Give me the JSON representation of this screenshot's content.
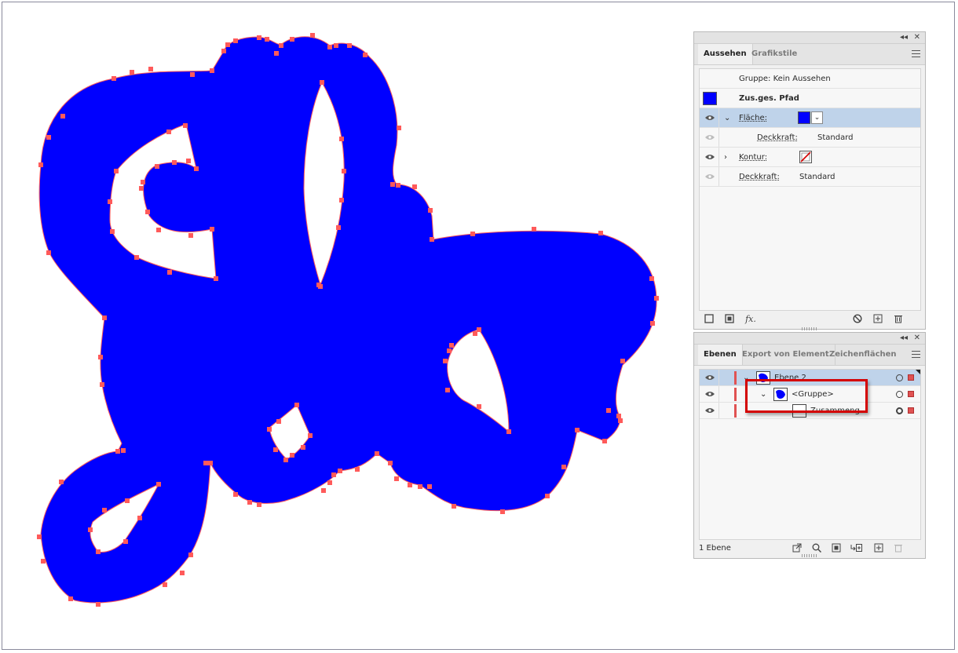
{
  "canvas": {
    "fill_color": "#0000ff",
    "anchor_color": "#ff5a5a"
  },
  "appearance_panel": {
    "tabs": [
      "Aussehen",
      "Grafikstile"
    ],
    "active_tab": "Aussehen",
    "header_text": "Gruppe: Kein Aussehen",
    "object_label": "Zus.ges. Pfad",
    "rows": [
      {
        "label": "Fläche:",
        "value": "",
        "swatch_color": "#0000ff"
      },
      {
        "label": "Deckkraft:",
        "value": "Standard"
      },
      {
        "label": "Kontur:",
        "value": ""
      },
      {
        "label": "Deckkraft:",
        "value": "Standard"
      }
    ],
    "footer_icons": [
      "new-stroke-icon",
      "new-fill-icon",
      "fx-icon",
      "clear-appearance-icon",
      "duplicate-item-icon",
      "delete-item-icon"
    ],
    "fx_label": "fx."
  },
  "layers_panel": {
    "tabs": [
      "Ebenen",
      "Export von Element",
      "Zeichenflächen"
    ],
    "active_tab": "Ebenen",
    "rows": [
      {
        "name": "Ebene 2",
        "level": 0
      },
      {
        "name": "<Gruppe>",
        "level": 1
      },
      {
        "name": "Zusammeng...",
        "level": 2
      }
    ],
    "status": "1 Ebene",
    "footer_icons": [
      "export-icon",
      "locate-object-icon",
      "clipping-mask-icon",
      "new-sublayer-icon",
      "new-layer-icon",
      "delete-layer-icon"
    ]
  },
  "panel_controls": {
    "collapse_glyph": "◂◂",
    "close_glyph": "✕"
  }
}
